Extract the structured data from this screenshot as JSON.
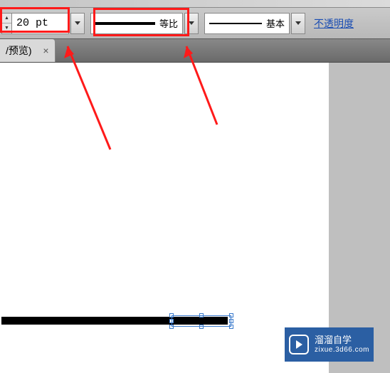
{
  "toolbar": {
    "strokeWidth": "20 pt",
    "profile": {
      "label": "等比"
    },
    "brush": {
      "label": "基本"
    },
    "opacityLabel": "不透明度"
  },
  "tab": {
    "label": "/预览)",
    "close": "×"
  },
  "watermark": {
    "title": "溜溜自学",
    "url": "zixue.3d66.com"
  }
}
